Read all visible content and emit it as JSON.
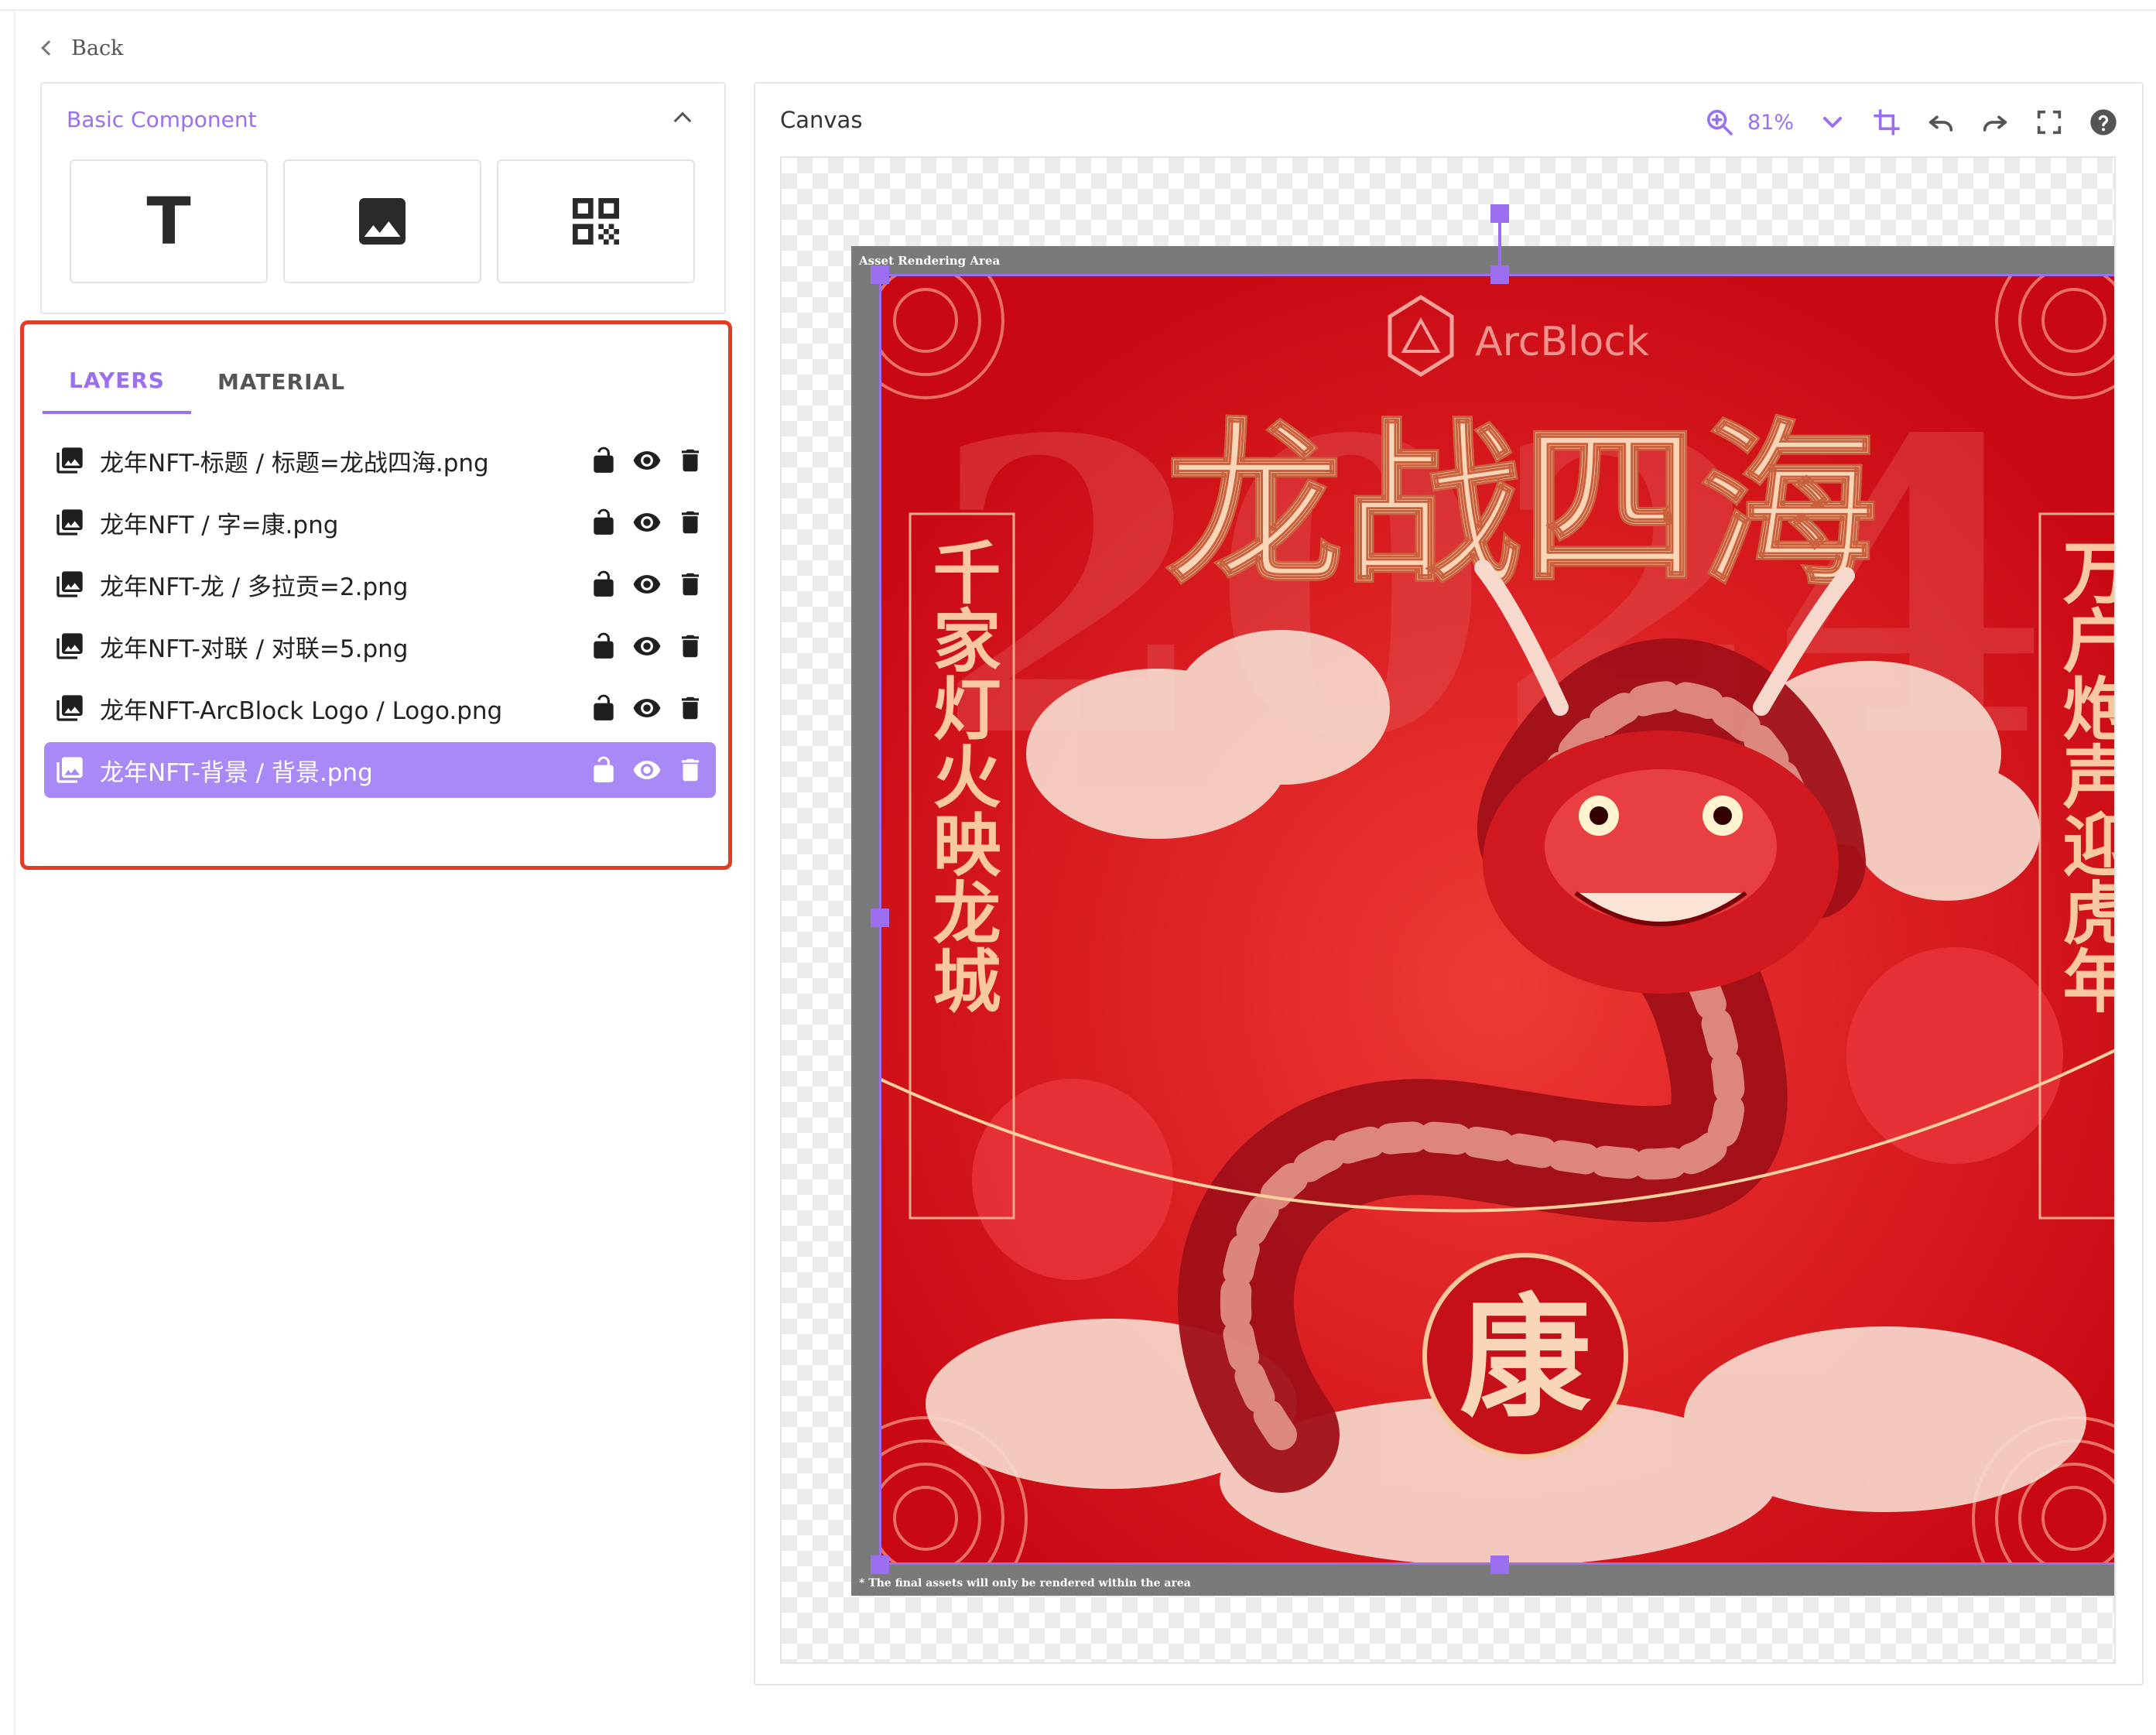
{
  "back": {
    "label": "Back"
  },
  "basic_component": {
    "title": "Basic Component",
    "tools": [
      {
        "name": "text-tool",
        "glyph": "T"
      },
      {
        "name": "image-tool",
        "icon": "image-icon"
      },
      {
        "name": "qrcode-tool",
        "icon": "qrcode-icon"
      }
    ]
  },
  "layers_panel": {
    "tabs": [
      {
        "label": "LAYERS",
        "active": true
      },
      {
        "label": "MATERIAL",
        "active": false
      }
    ],
    "rows": [
      {
        "name": "龙年NFT-标题 / 标题=龙战四海.png",
        "selected": false
      },
      {
        "name": "龙年NFT / 字=康.png",
        "selected": false
      },
      {
        "name": "龙年NFT-龙 / 多拉贡=2.png",
        "selected": false
      },
      {
        "name": "龙年NFT-对联 / 对联=5.png",
        "selected": false
      },
      {
        "name": "龙年NFT-ArcBlock Logo / Logo.png",
        "selected": false
      },
      {
        "name": "龙年NFT-背景 / 背景.png",
        "selected": true
      }
    ]
  },
  "canvas": {
    "title": "Canvas",
    "zoom": "81%",
    "render_area_label": "Asset Rendering Area",
    "render_area_note": "* The final assets will only be rendered within the area"
  },
  "artwork": {
    "title": "龙战四海",
    "year": "2024",
    "logo": "ArcBlock",
    "left_couplet": "千家灯火映龙城",
    "right_couplet": "万户炮声迎虎年",
    "center_char": "康"
  },
  "colors": {
    "accent": "#9b6ff0",
    "highlight": "#e53b24",
    "artwork_red": "#d9101a"
  }
}
